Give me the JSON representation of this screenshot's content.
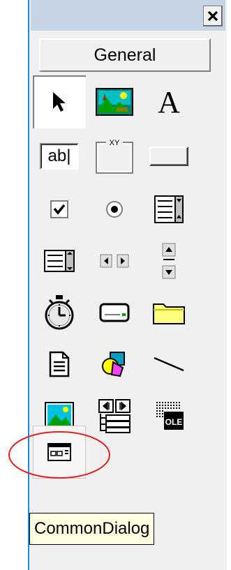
{
  "toolbox": {
    "tab_label": "General",
    "tooltip": "CommonDialog",
    "tools": [
      {
        "icon": "pointer-icon"
      },
      {
        "icon": "picturebox-icon"
      },
      {
        "icon": "label-icon",
        "glyph": "A"
      },
      {
        "icon": "textbox-icon",
        "glyph": "ab|"
      },
      {
        "icon": "frame-icon",
        "glyph": "XY"
      },
      {
        "icon": "commandbutton-icon"
      },
      {
        "icon": "checkbox-icon"
      },
      {
        "icon": "optionbutton-icon"
      },
      {
        "icon": "combobox-icon"
      },
      {
        "icon": "listbox-icon"
      },
      {
        "icon": "hscrollbar-icon"
      },
      {
        "icon": "vscrollbar-icon"
      },
      {
        "icon": "timer-icon"
      },
      {
        "icon": "drivelistbox-icon"
      },
      {
        "icon": "dirlistbox-icon"
      },
      {
        "icon": "filelistbox-icon"
      },
      {
        "icon": "shape-icon"
      },
      {
        "icon": "line-icon"
      },
      {
        "icon": "image-icon"
      },
      {
        "icon": "data-icon"
      },
      {
        "icon": "ole-icon",
        "glyph": "OLE"
      },
      {
        "icon": "commondialog-icon"
      }
    ]
  },
  "colors": {
    "accent_border": "#1a8ae0",
    "annotation": "#e02020",
    "tooltip_bg": "#ffffe1"
  }
}
